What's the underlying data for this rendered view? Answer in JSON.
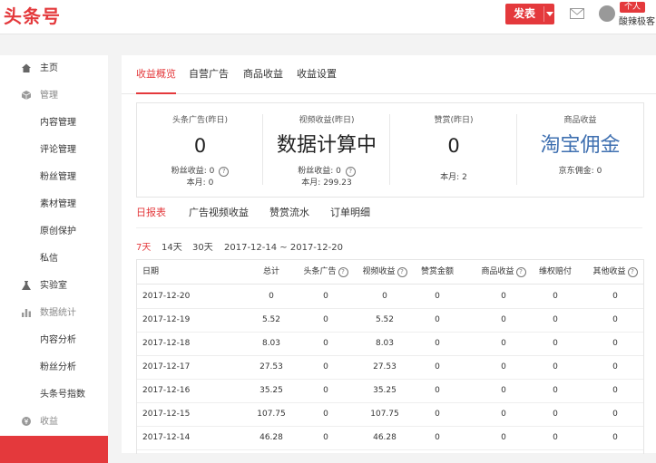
{
  "header": {
    "logo": "头条号",
    "publish_label": "发表",
    "role_badge": "个人",
    "username": "酸辣极客"
  },
  "sidebar": {
    "items": [
      {
        "label": "主页",
        "kind": "top",
        "icon": "home-icon"
      },
      {
        "label": "管理",
        "kind": "group",
        "icon": "cube-icon"
      },
      {
        "label": "内容管理",
        "kind": "sub"
      },
      {
        "label": "评论管理",
        "kind": "sub"
      },
      {
        "label": "粉丝管理",
        "kind": "sub"
      },
      {
        "label": "素材管理",
        "kind": "sub"
      },
      {
        "label": "原创保护",
        "kind": "sub"
      },
      {
        "label": "私信",
        "kind": "sub"
      },
      {
        "label": "实验室",
        "kind": "top",
        "icon": "flask-icon"
      },
      {
        "label": "数据统计",
        "kind": "group",
        "icon": "bar-chart-icon"
      },
      {
        "label": "内容分析",
        "kind": "sub"
      },
      {
        "label": "粉丝分析",
        "kind": "sub"
      },
      {
        "label": "头条号指数",
        "kind": "sub"
      },
      {
        "label": "收益",
        "kind": "group",
        "icon": "coin-icon"
      },
      {
        "label": "",
        "kind": "active"
      }
    ]
  },
  "tabs": [
    "收益概览",
    "自营广告",
    "商品收益",
    "收益设置"
  ],
  "summary": {
    "ad": {
      "title": "头条广告(昨日)",
      "value": "0",
      "fans_label": "粉丝收益:",
      "fans_value": "0",
      "month_label": "本月:",
      "month_value": "0"
    },
    "video": {
      "title": "视频收益(昨日)",
      "value": "数据计算中",
      "fans_label": "粉丝收益:",
      "fans_value": "0",
      "month_label": "本月:",
      "month_value": "299.23"
    },
    "reward": {
      "title": "赞赏(昨日)",
      "value": "0",
      "month_label": "本月:",
      "month_value": "2"
    },
    "goods": {
      "title": "商品收益",
      "value": "淘宝佣金",
      "jd_label": "京东佣金:",
      "jd_value": "0"
    }
  },
  "subtabs": [
    "日报表",
    "广告视频收益",
    "赞赏流水",
    "订单明细"
  ],
  "filters": {
    "ranges": [
      "7天",
      "14天",
      "30天"
    ],
    "date_range": "2017-12-14 ~ 2017-12-20"
  },
  "table": {
    "headers": [
      "日期",
      "总计",
      "头条广告",
      "视频收益",
      "赞赏金额",
      "商品收益",
      "维权赔付",
      "其他收益"
    ],
    "rows": [
      [
        "2017-12-20",
        "0",
        "0",
        "0",
        "0",
        "0",
        "0",
        "0"
      ],
      [
        "2017-12-19",
        "5.52",
        "0",
        "5.52",
        "0",
        "0",
        "0",
        "0"
      ],
      [
        "2017-12-18",
        "8.03",
        "0",
        "8.03",
        "0",
        "0",
        "0",
        "0"
      ],
      [
        "2017-12-17",
        "27.53",
        "0",
        "27.53",
        "0",
        "0",
        "0",
        "0"
      ],
      [
        "2017-12-16",
        "35.25",
        "0",
        "35.25",
        "0",
        "0",
        "0",
        "0"
      ],
      [
        "2017-12-15",
        "107.75",
        "0",
        "107.75",
        "0",
        "0",
        "0",
        "0"
      ],
      [
        "2017-12-14",
        "46.28",
        "0",
        "46.28",
        "0",
        "0",
        "0",
        "0"
      ]
    ]
  },
  "colors": {
    "brand": "#e4393c",
    "link_blue": "#3e6fb0"
  }
}
